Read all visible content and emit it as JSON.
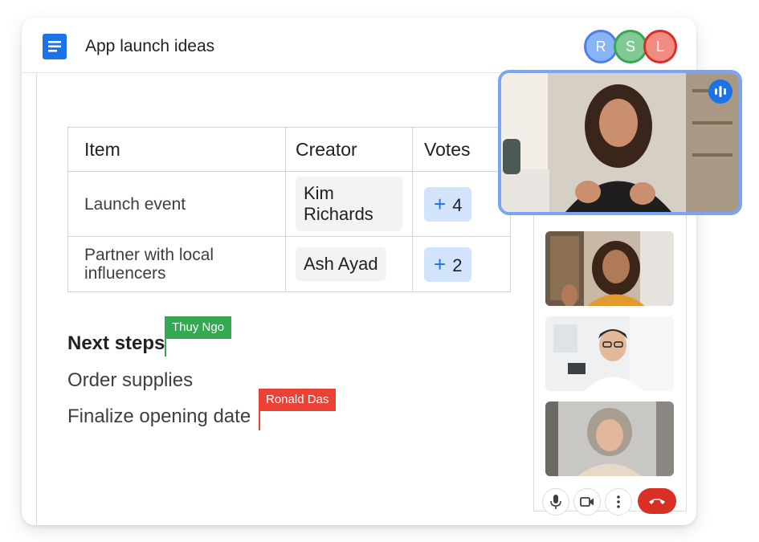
{
  "header": {
    "title": "App launch ideas",
    "icon": "docs-icon",
    "collaborators": [
      "R",
      "S",
      "L"
    ]
  },
  "table": {
    "columns": [
      "Item",
      "Creator",
      "Votes"
    ],
    "rows": [
      {
        "item": "Launch event",
        "creator": "Kim Richards",
        "votes": "4"
      },
      {
        "item": "Partner with local influencers",
        "creator": "Ash Ayad",
        "votes": "2"
      }
    ]
  },
  "vote_symbol": "+",
  "content": {
    "heading": "Next steps",
    "lines": [
      "Order supplies",
      "Finalize opening date"
    ]
  },
  "cursors": [
    {
      "name": "Thuy Ngo",
      "color": "#34a853"
    },
    {
      "name": "Ronald Das",
      "color": "#ea4335"
    }
  ],
  "meet": {
    "controls": [
      "microphone-icon",
      "camera-icon",
      "more-vert-icon",
      "end-call-icon"
    ],
    "end_call_color": "#d93025",
    "active_speaker_indicator": "audio-levels-icon"
  },
  "colors": {
    "accent_blue": "#1a73e8",
    "vote_chip": "#d2e3fc"
  }
}
